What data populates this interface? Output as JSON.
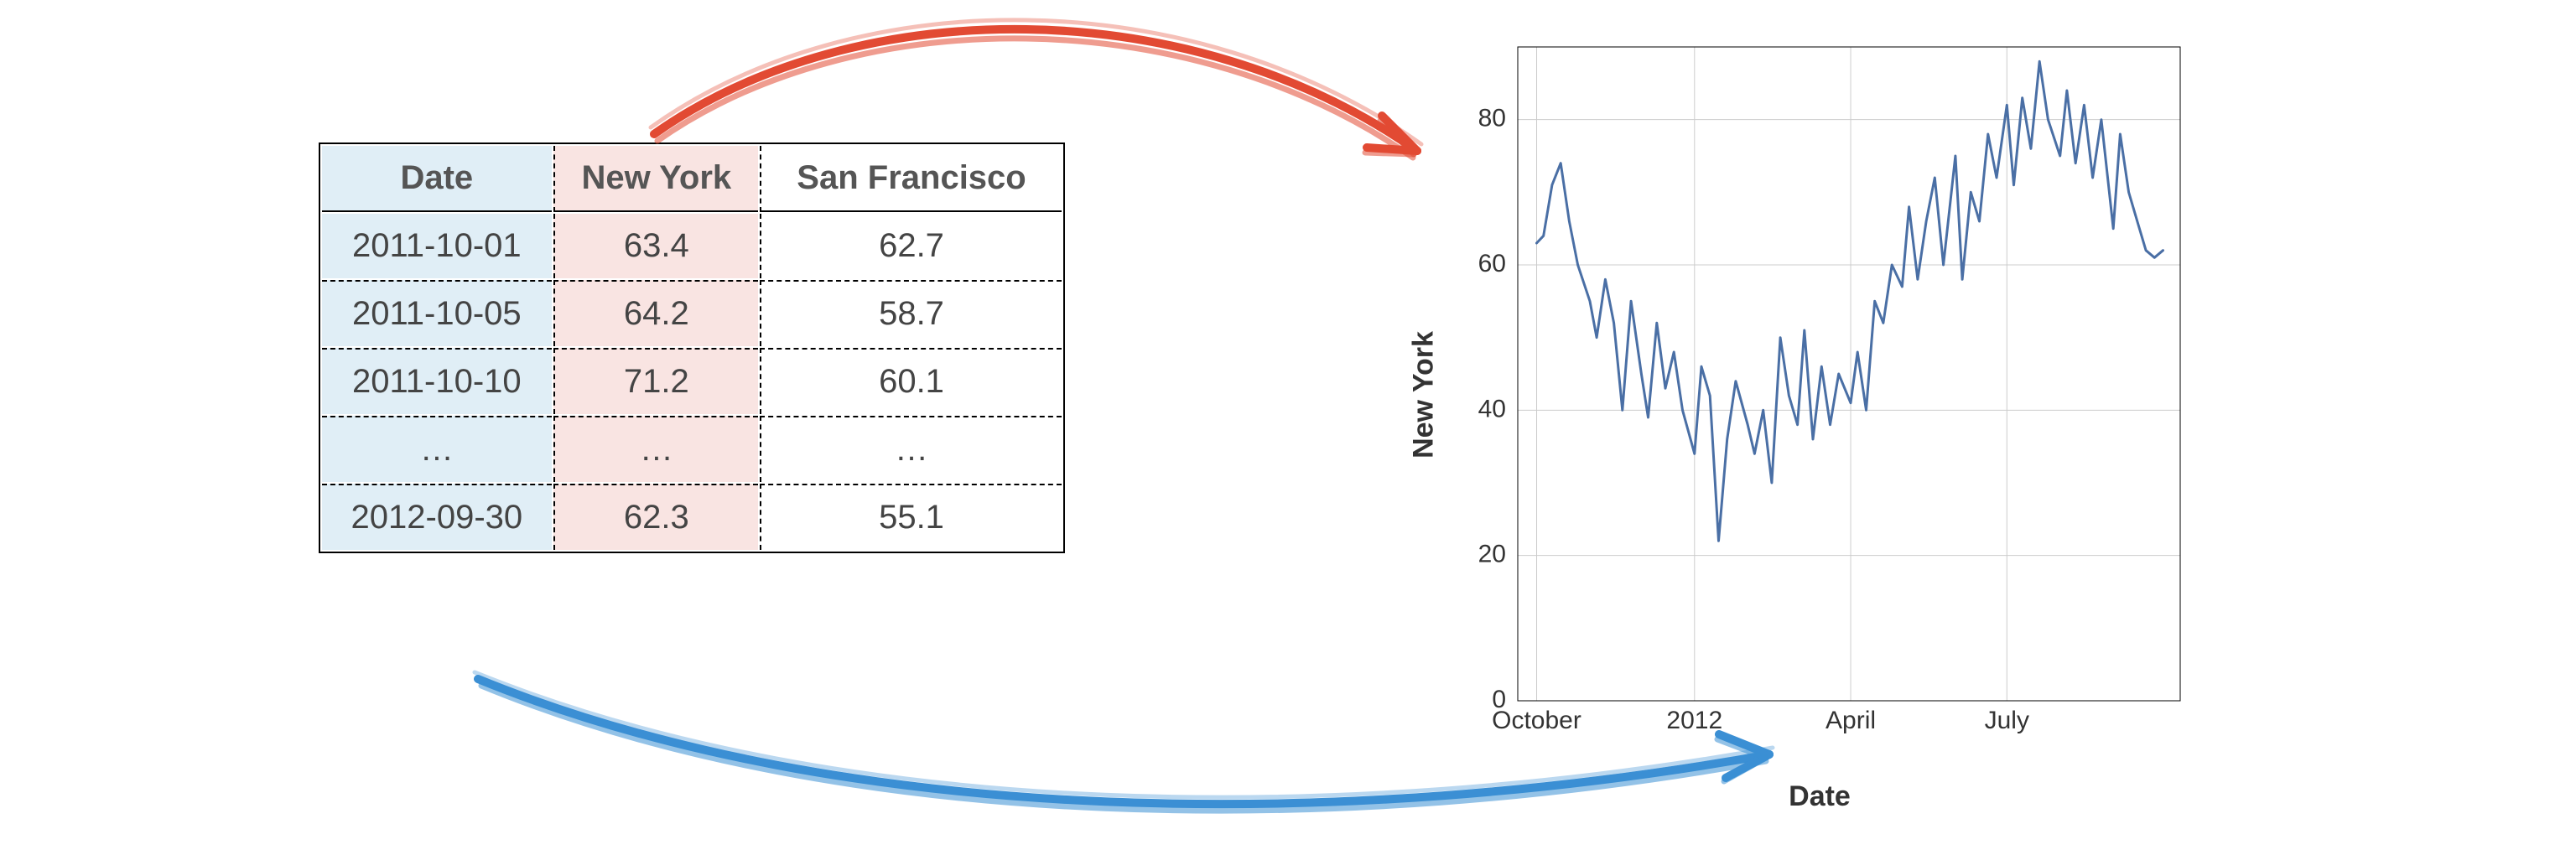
{
  "table": {
    "columns": [
      "Date",
      "New York",
      "San Francisco"
    ],
    "rows": [
      {
        "date": "2011-10-01",
        "ny": "63.4",
        "sf": "62.7"
      },
      {
        "date": "2011-10-05",
        "ny": "64.2",
        "sf": "58.7"
      },
      {
        "date": "2011-10-10",
        "ny": "71.2",
        "sf": "60.1"
      },
      {
        "date": "…",
        "ny": "…",
        "sf": "…"
      },
      {
        "date": "2012-09-30",
        "ny": "62.3",
        "sf": "55.1"
      }
    ]
  },
  "chart": {
    "xlabel": "Date",
    "ylabel": "New York",
    "y_ticks": [
      0,
      20,
      40,
      60,
      80
    ],
    "x_ticks": [
      "October",
      "2012",
      "April",
      "July"
    ]
  },
  "arrows": {
    "red_color": "#e24a33",
    "blue_color": "#3b8fd4"
  },
  "chart_data": {
    "type": "line",
    "title": "",
    "xlabel": "Date",
    "ylabel": "New York",
    "ylim": [
      0,
      90
    ],
    "xlim": [
      "2011-09-20",
      "2012-10-10"
    ],
    "grid": true,
    "legend": false,
    "x_ticks": [
      {
        "label": "October",
        "value": "2011-10-01"
      },
      {
        "label": "2012",
        "value": "2012-01-01"
      },
      {
        "label": "April",
        "value": "2012-04-01"
      },
      {
        "label": "July",
        "value": "2012-07-01"
      }
    ],
    "y_ticks": [
      0,
      20,
      40,
      60,
      80
    ],
    "series": [
      {
        "name": "New York",
        "color": "#4a6fa5",
        "x": [
          "2011-10-01",
          "2011-10-05",
          "2011-10-10",
          "2011-10-15",
          "2011-10-20",
          "2011-10-25",
          "2011-11-01",
          "2011-11-05",
          "2011-11-10",
          "2011-11-15",
          "2011-11-20",
          "2011-11-25",
          "2011-12-01",
          "2011-12-05",
          "2011-12-10",
          "2011-12-15",
          "2011-12-20",
          "2011-12-25",
          "2012-01-01",
          "2012-01-05",
          "2012-01-10",
          "2012-01-15",
          "2012-01-20",
          "2012-01-25",
          "2012-02-01",
          "2012-02-05",
          "2012-02-10",
          "2012-02-15",
          "2012-02-20",
          "2012-02-25",
          "2012-03-01",
          "2012-03-05",
          "2012-03-10",
          "2012-03-15",
          "2012-03-20",
          "2012-03-25",
          "2012-04-01",
          "2012-04-05",
          "2012-04-10",
          "2012-04-15",
          "2012-04-20",
          "2012-04-25",
          "2012-05-01",
          "2012-05-05",
          "2012-05-10",
          "2012-05-15",
          "2012-05-20",
          "2012-05-25",
          "2012-06-01",
          "2012-06-05",
          "2012-06-10",
          "2012-06-15",
          "2012-06-20",
          "2012-06-25",
          "2012-07-01",
          "2012-07-05",
          "2012-07-10",
          "2012-07-15",
          "2012-07-20",
          "2012-07-25",
          "2012-08-01",
          "2012-08-05",
          "2012-08-10",
          "2012-08-15",
          "2012-08-20",
          "2012-08-25",
          "2012-09-01",
          "2012-09-05",
          "2012-09-10",
          "2012-09-15",
          "2012-09-20",
          "2012-09-25",
          "2012-09-30"
        ],
        "values": [
          63,
          64,
          71,
          74,
          66,
          60,
          55,
          50,
          58,
          52,
          40,
          55,
          45,
          39,
          52,
          43,
          48,
          40,
          34,
          46,
          42,
          22,
          36,
          44,
          38,
          34,
          40,
          30,
          50,
          42,
          38,
          51,
          36,
          46,
          38,
          45,
          41,
          48,
          40,
          55,
          52,
          60,
          57,
          68,
          58,
          66,
          72,
          60,
          75,
          58,
          70,
          66,
          78,
          72,
          82,
          71,
          83,
          76,
          88,
          80,
          75,
          84,
          74,
          82,
          72,
          80,
          65,
          78,
          70,
          66,
          62,
          61,
          62
        ]
      }
    ]
  }
}
